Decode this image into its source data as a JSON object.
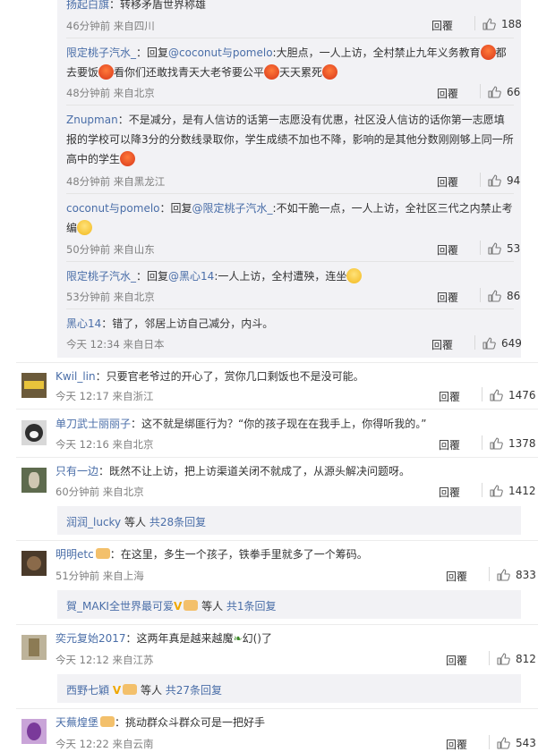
{
  "sub_replies": [
    {
      "author": "扬起白旗",
      "text": "：转移矛盾世界称雄",
      "time": "46分钟前",
      "source": "来自四川",
      "reply_label": "回覆",
      "likes": "188"
    },
    {
      "author": "限定桃子汽水_",
      "pre": "：回复",
      "mention": "@coconut与pomelo",
      "text1": ":大胆点，一人上访，全村禁止九年义务教育",
      "text2": "都去要饭",
      "text3": "看你们还敢找青天大老爷要公平",
      "text4": "天天累死",
      "time": "48分钟前",
      "source": "来自北京",
      "reply_label": "回覆",
      "likes": "66"
    },
    {
      "author": "Znupman",
      "text": "：不是减分，是有人信访的话第一志愿没有优惠，社区没人信访的话你第一志愿填报的学校可以降3分的分数线录取你，学生成绩不加也不降，影响的是其他分数刚刚够上同一所高中的学生",
      "time": "48分钟前",
      "source": "来自黑龙江",
      "reply_label": "回覆",
      "likes": "94"
    },
    {
      "author": "coconut与pomelo",
      "pre": "：回复",
      "mention": "@限定桃子汽水_",
      "text1": ":不如干脆一点，一人上访，全社区三代之内禁止考编",
      "time": "50分钟前",
      "source": "来自山东",
      "reply_label": "回覆",
      "likes": "53"
    },
    {
      "author": "限定桃子汽水_",
      "pre": "：回复",
      "mention": "@黑心14",
      "text1": ":一人上访，全村遭殃，连坐",
      "time": "53分钟前",
      "source": "来自北京",
      "reply_label": "回覆",
      "likes": "86"
    },
    {
      "author": "黑心14",
      "text": "：错了，邻居上访自己减分，内斗。",
      "time": "今天 12:34",
      "source": "来自日本",
      "reply_label": "回覆",
      "likes": "649"
    }
  ],
  "comments": [
    {
      "author": "Kwil_lin",
      "text": "：只要官老爷过的开心了，赏你几口剩饭也不是没可能。",
      "time": "今天 12:17",
      "source": "来自浙江",
      "reply_label": "回覆",
      "likes": "1476"
    },
    {
      "author": "单刀武士丽丽子",
      "text": "：这不就是绑匪行为？“你的孩子现在在我手上，你得听我的。”",
      "time": "今天 12:16",
      "source": "来自北京",
      "reply_label": "回覆",
      "likes": "1378"
    },
    {
      "author": "只有一边",
      "text": "：既然不让上访，把上访渠道关闭不就成了，从源头解决问题呀。",
      "time": "60分钟前",
      "source": "来自北京",
      "reply_label": "回覆",
      "likes": "1412",
      "more_user": "润润_lucky",
      "more_text": " 等人 ",
      "more_count": "共28条回复"
    },
    {
      "author": "明明etc",
      "text": "：在这里，多生一个孩子，铁拳手里就多了一个筹码。",
      "time": "51分钟前",
      "source": "来自上海",
      "reply_label": "回覆",
      "likes": "833",
      "more_user": "賀_MAKI全世界最可爱",
      "more_text": " 等人 ",
      "more_count": "共1条回复"
    },
    {
      "author": "奕元复始2017",
      "text": "：这两年真是越来越魔",
      "text_tail": "幻()了",
      "time": "今天 12:12",
      "source": "来自江苏",
      "reply_label": "回覆",
      "likes": "812",
      "more_user": "西野七穎",
      "more_text": " 等人 ",
      "more_count": "共27条回复"
    },
    {
      "author": "天蕪煌堡",
      "text": "：挑动群众斗群众可是一把好手",
      "time": "今天 12:22",
      "source": "来自云南",
      "reply_label": "回覆",
      "likes": "543"
    }
  ],
  "colors": {
    "link": "#4a6ea8",
    "meta": "#808080",
    "reply_bg": "#f2f2f5"
  }
}
